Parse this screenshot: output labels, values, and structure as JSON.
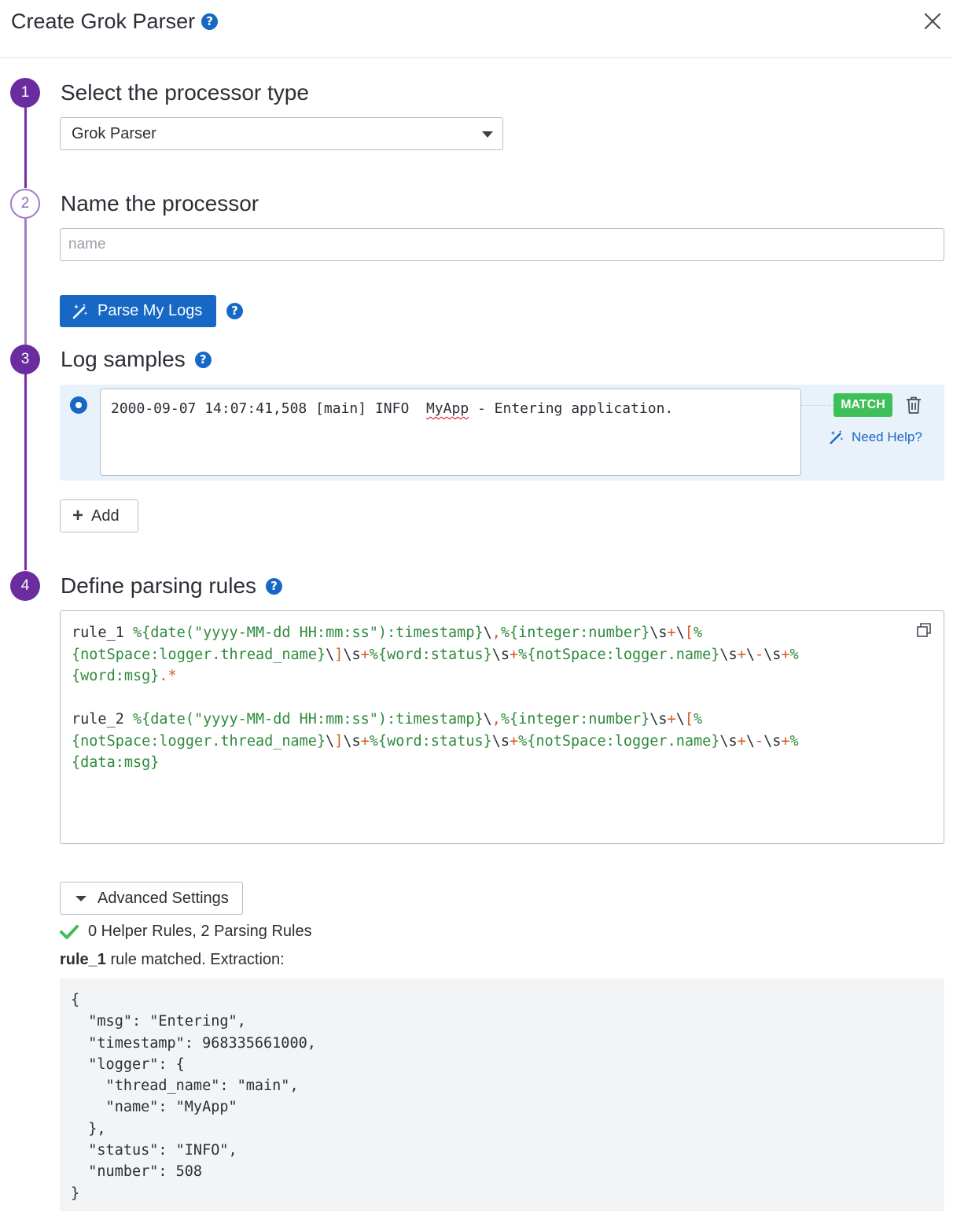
{
  "header": {
    "title": "Create Grok Parser"
  },
  "steps": {
    "s1": {
      "number": "1",
      "title": "Select the processor type",
      "selected": "Grok Parser"
    },
    "s2": {
      "number": "2",
      "title": "Name the processor",
      "placeholder": "name",
      "value": ""
    },
    "parse_button": "Parse My Logs",
    "s3": {
      "number": "3",
      "title": "Log samples",
      "sample_prefix": "2000-09-07 14:07:41,508 [main] INFO  ",
      "sample_word": "MyApp",
      "sample_suffix": " - Entering application.",
      "badge": "MATCH",
      "need_help": "Need Help?",
      "add_label": "Add"
    },
    "s4": {
      "number": "4",
      "title": "Define parsing rules"
    }
  },
  "rules": [
    [
      "rule_1 %{date(\"yyyy-MM-dd HH:mm:ss\"):timestamp}\\,%{integer:number}\\s+\\[%",
      "{notSpace:logger.thread_name}\\]\\s+%{word:status}\\s+%{notSpace:logger.name}\\s+\\-\\s+%",
      "{word:msg}.*"
    ],
    [
      "rule_2 %{date(\"yyyy-MM-dd HH:mm:ss\"):timestamp}\\,%{integer:number}\\s+\\[%",
      "{notSpace:logger.thread_name}\\]\\s+%{word:status}\\s+%{notSpace:logger.name}\\s+\\-\\s+%",
      "{data:msg}"
    ]
  ],
  "advanced_settings": "Advanced Settings",
  "rules_count": "0 Helper Rules, 2 Parsing Rules",
  "matched_rule": "rule_1",
  "matched_text": " rule matched. Extraction:",
  "extraction": "{\n  \"msg\": \"Entering\",\n  \"timestamp\": 968335661000,\n  \"logger\": {\n    \"thread_name\": \"main\",\n    \"name\": \"MyApp\"\n  },\n  \"status\": \"INFO\",\n  \"number\": 508\n}",
  "colors": {
    "accent": "#1668c4",
    "step": "#6a2c9f",
    "match": "#3fbf5a",
    "sample_bg": "#e9f2fa"
  }
}
